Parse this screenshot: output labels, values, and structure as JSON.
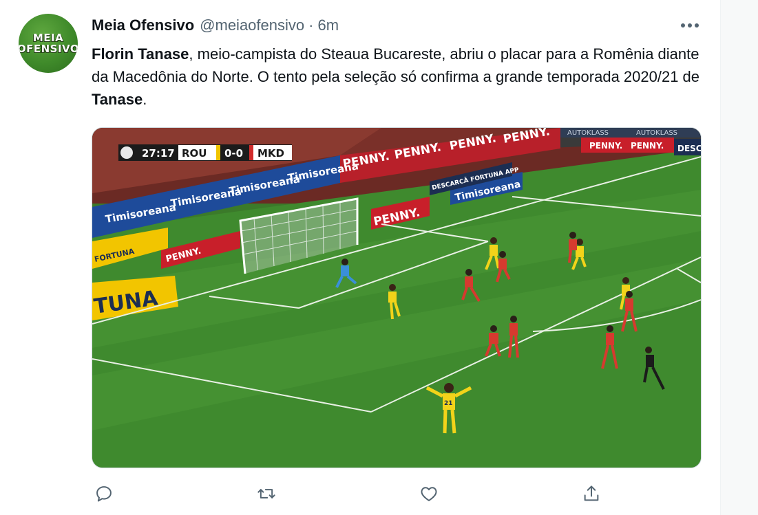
{
  "tweet": {
    "author": {
      "name": "Meia Ofensivo",
      "handle": "@meiaofensivo",
      "separator": "·",
      "time": "6m",
      "avatar_line1": "MEIA",
      "avatar_line2": "OFENSIVO"
    },
    "text": {
      "bold_start": "Florin Tanase",
      "middle": ", meio-campista do Steaua Bucareste, abriu o placar para a Romênia diante da Macedônia do Norte. O tento pela seleção só confirma a grande temporada 2020/21 de ",
      "bold_end": "Tanase",
      "end": "."
    },
    "media": {
      "scoreboard": {
        "clock": "27:17",
        "home": "ROU",
        "score": "0-0",
        "away": "MKD"
      },
      "ads": {
        "penny": "PENNY.",
        "timisoreana": "Timisoreana",
        "fortuna": "FORTUNA",
        "fortuna_big": "TUNA",
        "descarca": "DESCARCĂ FORTUNA APP",
        "autoklass": "AUTOKLASS",
        "desc_short": "DESC"
      },
      "player_number": "21"
    },
    "actions": [
      {
        "name": "reply-icon"
      },
      {
        "name": "retweet-icon"
      },
      {
        "name": "like-icon"
      },
      {
        "name": "share-icon"
      }
    ],
    "colors": {
      "text_primary": "#0f1419",
      "text_secondary": "#536471",
      "icon": "#536471",
      "border": "#cfd9de"
    }
  }
}
